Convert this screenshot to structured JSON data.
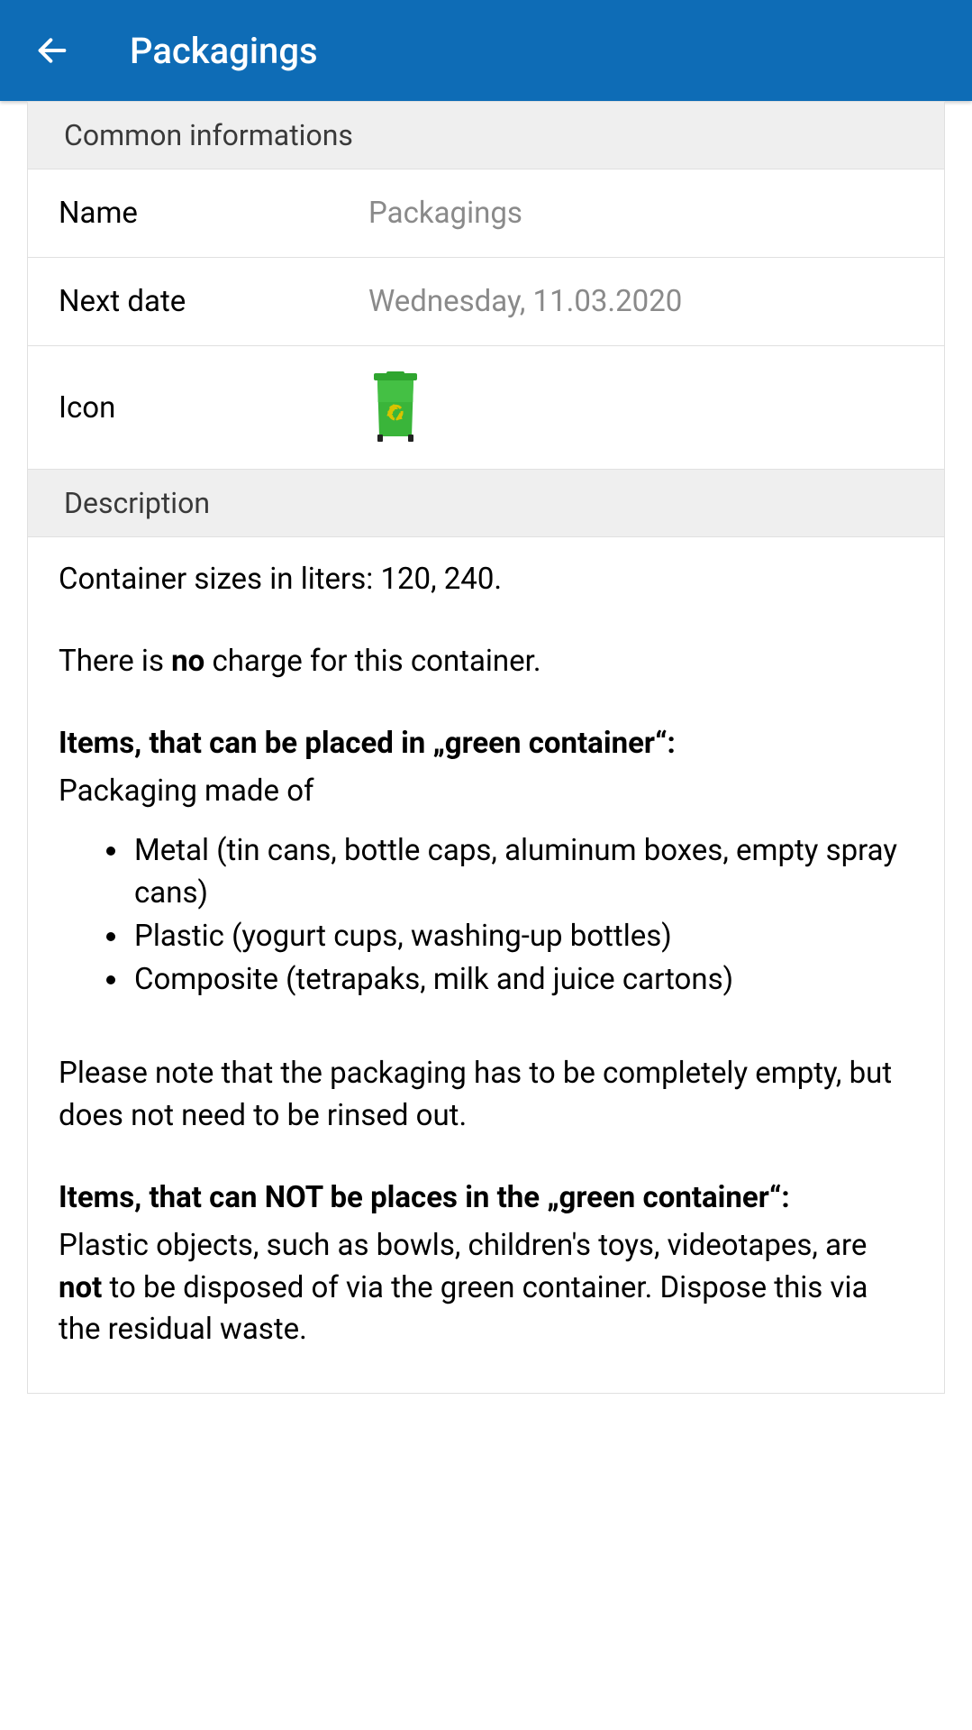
{
  "header": {
    "title": "Packagings"
  },
  "sections": {
    "common": {
      "header": "Common informations",
      "name_label": "Name",
      "name_value": "Packagings",
      "next_date_label": "Next date",
      "next_date_value": "Wednesday, 11.03.2020",
      "icon_label": "Icon"
    },
    "description": {
      "header": "Description",
      "line_sizes": "Container sizes in liters: 120, 240.",
      "charge_pre": "There is ",
      "charge_bold": "no",
      "charge_post": " charge for this container.",
      "can_heading": "Items, that can be placed in „green container“:",
      "can_intro": "Packaging made of",
      "can_items": [
        "Metal (tin cans, bottle caps, aluminum boxes, empty spray cans)",
        "Plastic (yogurt cups, washing-up bottles)",
        "Composite (tetrapaks, milk and juice cartons)"
      ],
      "note": "Please note that the packaging has to be completely empty, but does not need to be rinsed out.",
      "cannot_heading": "Items, that can NOT be places in the „green container“:",
      "cannot_pre": "Plastic objects, such as bowls, children's toys, videotapes, are ",
      "cannot_bold": "not",
      "cannot_post": " to be disposed of via the green container. Dispose this via the residual waste."
    }
  }
}
